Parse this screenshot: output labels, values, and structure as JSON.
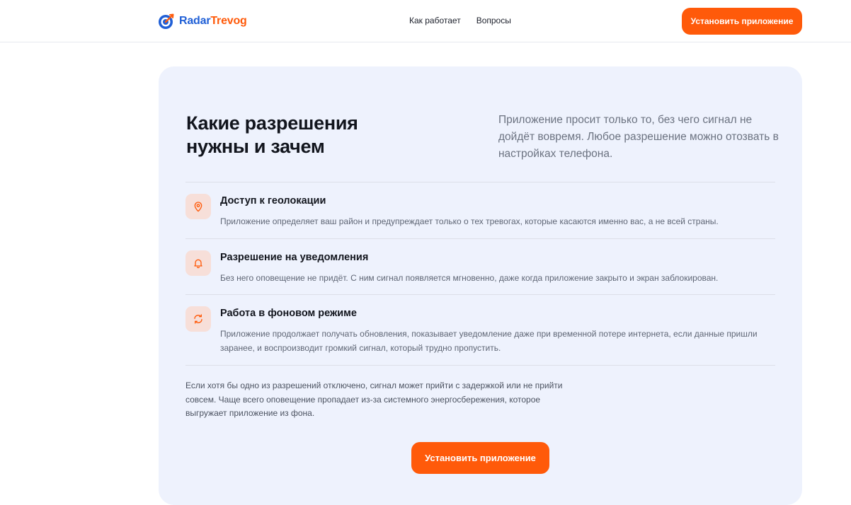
{
  "header": {
    "logo": {
      "part1": "Radar",
      "part2": "Trevog",
      "icon": "radar-target-icon"
    },
    "nav": [
      {
        "label": "Как работает"
      },
      {
        "label": "Вопросы"
      }
    ],
    "install_label": "Установить приложение"
  },
  "section": {
    "title_line1": "Какие разрешения",
    "title_line2": "нужны и зачем",
    "intro": "Приложение просит только то, без чего сигнал не дойдёт вовремя. Любое разрешение можно отозвать в настройках телефона.",
    "permissions": [
      {
        "icon": "location-pin-icon",
        "title": "Доступ к геолокации",
        "description": "Приложение определяет ваш район и предупреждает только о тех тревогах, которые касаются именно вас, а не всей страны."
      },
      {
        "icon": "bell-icon",
        "title": "Разрешение на уведомления",
        "description": "Без него оповещение не придёт. С ним сигнал появляется мгновенно, даже когда приложение закрыто и экран заблокирован."
      },
      {
        "icon": "refresh-icon",
        "title": "Работа в фоновом режиме",
        "description": "Приложение продолжает получать обновления, показывает уведомление даже при временной потере интернета, если данные пришли заранее, и воспроизводит громкий сигнал, который трудно пропустить."
      }
    ],
    "note": "Если хотя бы одно из разрешений отключено, сигнал может прийти с задержкой или не прийти совсем. Чаще всего оповещение пропадает из-за системного энергосбережения, которое выгружает приложение из фона.",
    "install_label": "Установить приложение"
  },
  "colors": {
    "accent": "#ff5a0a",
    "brand_blue": "#1f5fd6",
    "card_bg": "#eef2fd",
    "icon_bg": "#f7dfd9"
  }
}
